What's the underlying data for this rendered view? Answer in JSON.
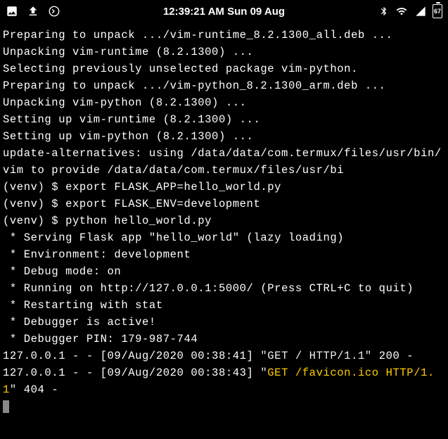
{
  "status_bar": {
    "time": "12:39:21 AM Sun 09 Aug",
    "battery": "67"
  },
  "terminal": {
    "lines": [
      "Preparing to unpack .../vim-runtime_8.2.1300_all.deb ...",
      "Unpacking vim-runtime (8.2.1300) ...",
      "Selecting previously unselected package vim-python.",
      "Preparing to unpack .../vim-python_8.2.1300_arm.deb ...",
      "Unpacking vim-python (8.2.1300) ...",
      "Setting up vim-runtime (8.2.1300) ...",
      "Setting up vim-python (8.2.1300) ...",
      "update-alternatives: using /data/data/com.termux/files/usr/bin/vim to provide /data/data/com.termux/files/usr/bi",
      "(venv) $ export FLASK_APP=hello_world.py",
      "(venv) $ export FLASK_ENV=development",
      "(venv) $ python hello_world.py",
      " * Serving Flask app \"hello_world\" (lazy loading)",
      " * Environment: development",
      " * Debug mode: on",
      " * Running on http://127.0.0.1:5000/ (Press CTRL+C to quit)",
      " * Restarting with stat",
      " * Debugger is active!",
      " * Debugger PIN: 179-987-744"
    ],
    "log1_prefix": "127.0.0.1 - - [09/Aug/2020 00:38:41] ",
    "log1_quoted": "\"GET / HTTP/1.1\"",
    "log1_suffix": " 200 -",
    "log2_prefix": "127.0.0.1 - - [09/Aug/2020 00:38:43] ",
    "log2_quoted_open": "\"",
    "log2_yellow": "GET /favicon.ico HTTP/1.1",
    "log2_quoted_close": "\"",
    "log2_suffix": " 404 -"
  }
}
